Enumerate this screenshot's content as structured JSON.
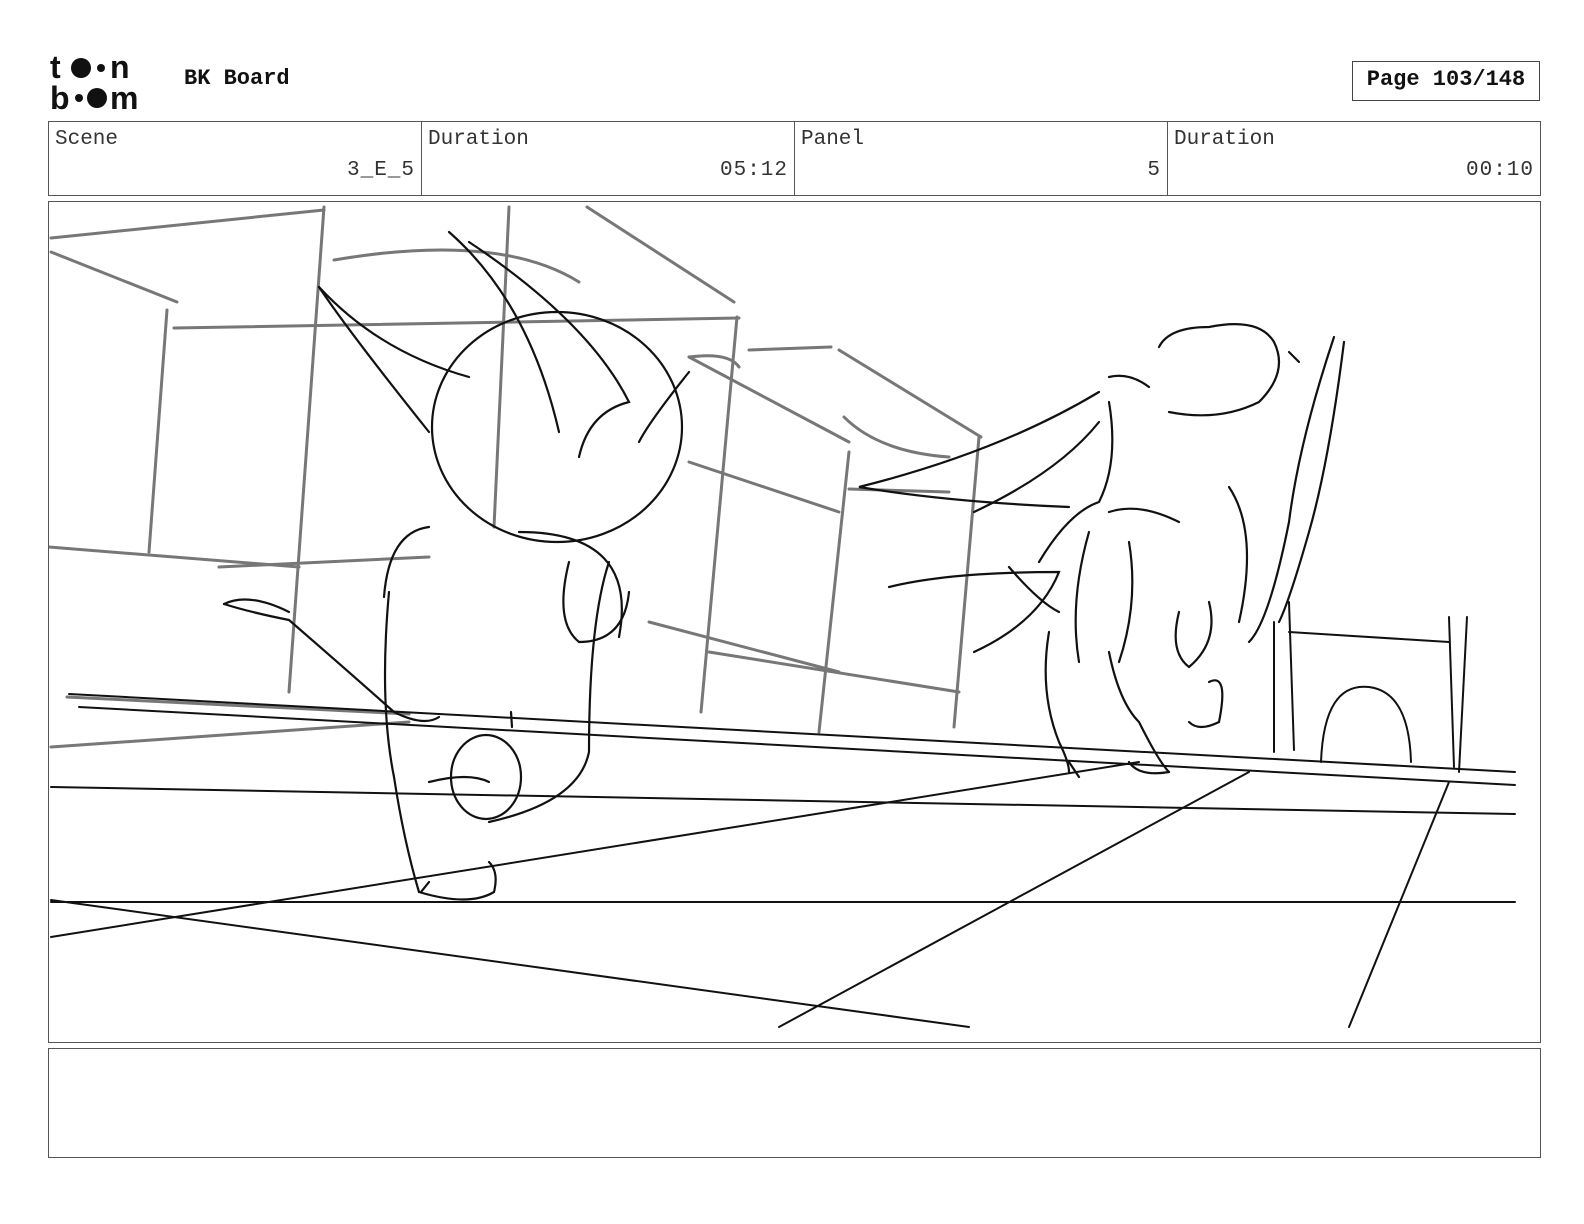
{
  "header": {
    "logo_text": "toon boom",
    "title": "BK Board",
    "page_label": "Page 103/148"
  },
  "info": {
    "scene_label": "Scene",
    "scene_value": "3_E_5",
    "duration_label": "Duration",
    "duration_value": "05:12",
    "panel_label": "Panel",
    "panel_value": "5",
    "panel_duration_label": "Duration",
    "panel_duration_value": "00:10"
  },
  "notes": {
    "text": ""
  }
}
